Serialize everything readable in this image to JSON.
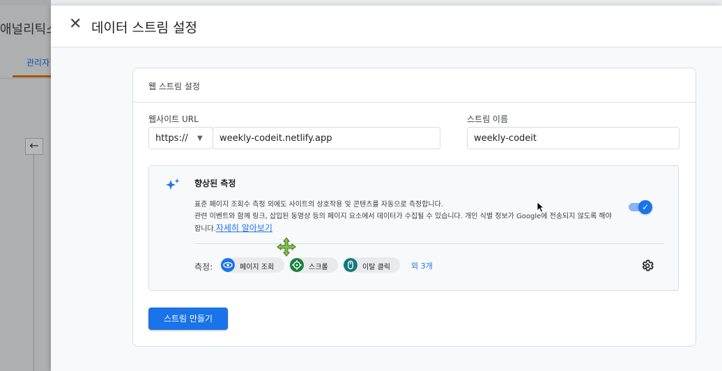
{
  "background": {
    "app_title": "애널리틱스",
    "tab_label": "관리자",
    "back_arrow": "←"
  },
  "panel": {
    "close_icon": "close-icon",
    "close_glyph": "✕",
    "title": "데이터 스트림 설정"
  },
  "card": {
    "title": "웹 스트림 설정",
    "url_label": "웹사이트 URL",
    "protocol_value": "https://",
    "url_value": "weekly-codeit.netlify.app",
    "stream_name_label": "스트림 이름",
    "stream_name_value": "weekly-codeit"
  },
  "enhanced": {
    "icon": "sparkle-icon",
    "title": "향상된 측정",
    "desc_line1": "표준 페이지 조회수 측정 외에도 사이트의 상호작용 및 콘텐츠를 자동으로 측정합니다.",
    "desc_line2": "관련 이벤트와 함께 링크, 삽입된 동영상 등의 페이지 요소에서 데이터가 수집될 수 있습니다. 개인 식별 정보가 Google에 전송되지 않도록 해야",
    "desc_line3": "합니다.",
    "learn_more": "자세히 알아보기",
    "toggle_on": true,
    "measure_label": "측정:",
    "chips": [
      {
        "label": "페이지 조회",
        "icon": "eye-icon",
        "color": "#1a73e8"
      },
      {
        "label": "스크롤",
        "icon": "crosshair-icon",
        "color": "#188038"
      },
      {
        "label": "이탈 클릭",
        "icon": "mouse-icon",
        "color": "#12797b"
      }
    ],
    "more_link": "외 3개"
  },
  "actions": {
    "create_button": "스트림 만들기"
  },
  "colors": {
    "accent": "#1a73e8",
    "tab_underline": "#e37400"
  }
}
